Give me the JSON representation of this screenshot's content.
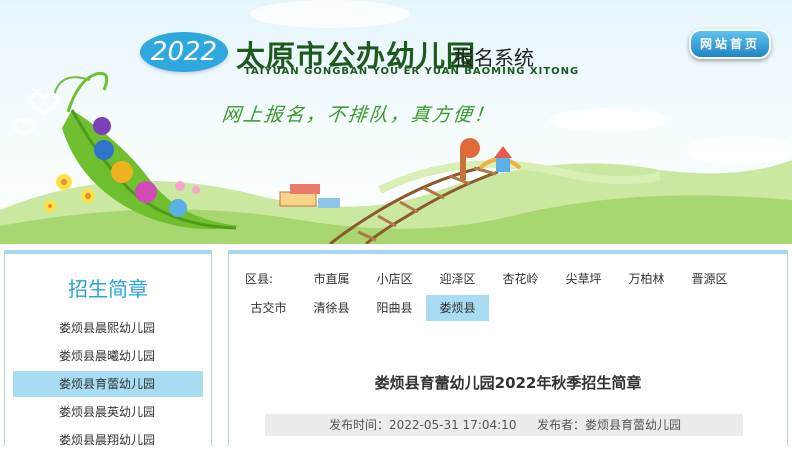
{
  "header": {
    "year": "2022",
    "title": "太原市公办幼儿园",
    "subtitle": "报名系统",
    "pinyin": "TAIYUAN GONGBAN YOU ER YUAN BAOMING XITONG",
    "slogan": "网上报名，不排队，真方便！",
    "home_button": "网站首页"
  },
  "sidebar": {
    "title": "招生简章",
    "items": [
      {
        "label": "娄烦县晨熙幼儿园",
        "active": false
      },
      {
        "label": "娄烦县晨曦幼儿园",
        "active": false
      },
      {
        "label": "娄烦县育蕾幼儿园",
        "active": true
      },
      {
        "label": "娄烦县晨英幼儿园",
        "active": false
      },
      {
        "label": "娄烦县晨翔幼儿园",
        "active": false
      }
    ]
  },
  "districts": {
    "label": "区县:",
    "items": [
      "市直属",
      "小店区",
      "迎泽区",
      "杏花岭",
      "尖草坪",
      "万柏林",
      "晋源区",
      "古交市",
      "清徐县",
      "阳曲县",
      "娄烦县"
    ],
    "active": "娄烦县"
  },
  "article": {
    "title": "娄烦县育蕾幼儿园2022年秋季招生简章",
    "publish_time": "发布时间：2022-05-31 17:04:10",
    "publisher": "发布者：娄烦县育蕾幼儿园"
  }
}
